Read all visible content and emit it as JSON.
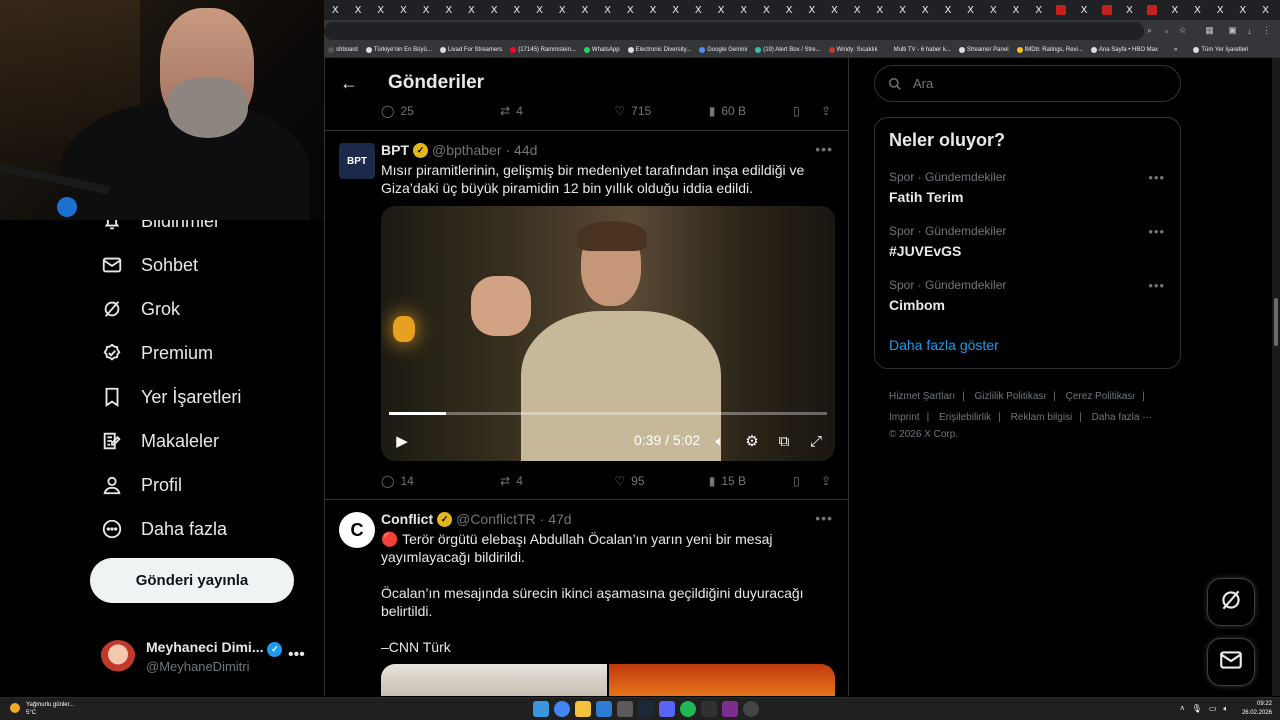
{
  "browser": {
    "tab_glyph": "X",
    "bookmarks": [
      {
        "label": "shboard",
        "color": "#555"
      },
      {
        "label": "Türkiye'nin En Büyü...",
        "color": "#ddd"
      },
      {
        "label": "Livad For Streamers",
        "color": "#ddd"
      },
      {
        "label": "(17145) Rammstein...",
        "color": "#ff0033"
      },
      {
        "label": "WhatsApp",
        "color": "#25d366"
      },
      {
        "label": "Electronic Diversity...",
        "color": "#ddd"
      },
      {
        "label": "Google Gemini",
        "color": "#4f8cf7"
      },
      {
        "label": "(19) Alert Box / Stre...",
        "color": "#31c3a2"
      },
      {
        "label": "Windy: Sıcaklık",
        "color": "#c0392b"
      },
      {
        "label": "Multi TV - 6 haber k...",
        "color": "#333"
      },
      {
        "label": "Streamer Panel",
        "color": "#ddd"
      },
      {
        "label": "IMDb: Ratings, Revi...",
        "color": "#f5c518"
      },
      {
        "label": "Ana Sayfa • HBO Max",
        "color": "#ddd"
      },
      {
        "label": "»",
        "color": "transparent"
      },
      {
        "label": "Tüm Yer İşaretleri",
        "color": "#ddd"
      }
    ]
  },
  "nav": {
    "items": [
      {
        "label": "Bildirimler",
        "icon": "bell-icon"
      },
      {
        "label": "Sohbet",
        "icon": "mail-icon"
      },
      {
        "label": "Grok",
        "icon": "grok-icon"
      },
      {
        "label": "Premium",
        "icon": "verified-icon"
      },
      {
        "label": "Yer İşaretleri",
        "icon": "bookmark-icon"
      },
      {
        "label": "Makaleler",
        "icon": "article-icon"
      },
      {
        "label": "Profil",
        "icon": "profile-icon"
      },
      {
        "label": "Daha fazla",
        "icon": "more-circle-icon"
      }
    ],
    "post_button": "Gönderi yayınla",
    "account": {
      "name": "Meyhaneci Dimi...",
      "handle": "@MeyhaneDimitri",
      "more": "•••"
    }
  },
  "header": {
    "title": "Gönderiler"
  },
  "top_actions": {
    "replies": "25",
    "reposts": "4",
    "likes": "715",
    "views": "60 B"
  },
  "tweets": [
    {
      "name": "BPT",
      "handle": "@bpthaber",
      "time": "· 44d",
      "avatar_text": "BPT",
      "text": "Mısır piramitlerinin, gelişmiş bir medeniyet tarafından inşa edildiği ve Giza’daki üç büyük piramidin 12 bin yıllık olduğu iddia edildi.",
      "video": {
        "time": "0:39 / 5:02",
        "progress": 0.13
      },
      "actions": {
        "replies": "14",
        "reposts": "4",
        "likes": "95",
        "views": "15 B"
      }
    },
    {
      "name": "Conflict",
      "handle": "@ConflictTR",
      "time": "· 47d",
      "avatar_text": "C",
      "text": "🔴 Terör örgütü elebaşı Abdullah Öcalan’ın yarın yeni bir mesaj yayımlayacağı bildirildi.\n\nÖcalan’ın mesajında sürecin ikinci aşamasına geçildiğini duyuracağı belirtildi.\n\n–CNN Türk"
    }
  ],
  "search": {
    "placeholder": "Ara"
  },
  "trends": {
    "title": "Neler oluyor?",
    "items": [
      {
        "category": "Spor · Gündemdekiler",
        "name": "Fatih Terim"
      },
      {
        "category": "Spor · Gündemdekiler",
        "name": "#JUVEvGS"
      },
      {
        "category": "Spor · Gündemdekiler",
        "name": "Cimbom"
      }
    ],
    "show_more": "Daha fazla göster"
  },
  "footer": {
    "links": [
      "Hizmet Şartları",
      "Gizlilik Politikası",
      "Çerez Politikası",
      "Imprint",
      "Erişilebilirlik",
      "Reklam bilgisi",
      "Daha fazla ···"
    ],
    "copyright": "© 2026 X Corp."
  },
  "taskbar": {
    "weather_text": "Yağmurlu günler...",
    "weather_temp": "5°C",
    "time": "09:22",
    "date": "26.02.2026"
  },
  "colors": {
    "accent": "#1d9bf0",
    "verified": "#e2b719",
    "background": "#000000"
  }
}
